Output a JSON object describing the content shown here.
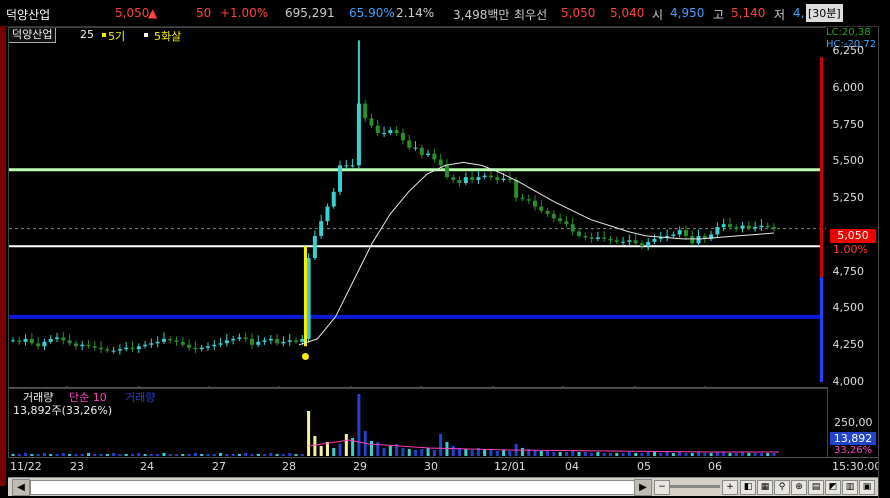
{
  "header": {
    "stock_name": "덕양산업",
    "price": "5,050",
    "up_arrow": "▲",
    "change": "50",
    "change_pct": "+1.00%",
    "volume": "695,291",
    "vol_ratio": "65.90%",
    "turnover": "2.14%",
    "trade_value": "3,498백만",
    "priority_label": "최우선",
    "ask": "5,050",
    "bid": "5,040",
    "open_label": "시",
    "open": "4,950",
    "high_label": "고",
    "high": "5,140",
    "low_label": "저",
    "low": "4,",
    "interval": "[30분]"
  },
  "legend": {
    "name": "덕양산업",
    "period": "25",
    "ma1": "5기",
    "ma2": "5화살"
  },
  "axis_right": {
    "lc": "LC:20,38",
    "hc": "HC:-20,72",
    "ticks": [
      "6,250",
      "6,000",
      "5,750",
      "5,500",
      "5,250",
      "5,000",
      "4,750",
      "4,500",
      "4,250",
      "4,000"
    ],
    "current_price": "5,050",
    "current_pct": "1.00%"
  },
  "volume_panel": {
    "label": "거래량",
    "label2": "단순 10",
    "label3": "거래량",
    "value": "13,892주(33,26%)",
    "tick": "250,00",
    "current": "13,892",
    "current_pct": "33,26%"
  },
  "x_axis": [
    "11/22",
    "23",
    "24",
    "27",
    "28",
    "29",
    "30",
    "12/01",
    "04",
    "05",
    "06"
  ],
  "time_label": "15:30:00",
  "colors": {
    "up": "#3ad0d0",
    "down": "#2a8c2a",
    "green_line": "#b8ffb0",
    "blue_line": "#0b1ad8",
    "white_line": "#ffffff",
    "yellow": "#f6f000",
    "price_box": "#e00000"
  },
  "chart_data": {
    "type": "candlestick",
    "ylim": [
      4000,
      6380
    ],
    "x": [
      "11/22",
      "23",
      "24",
      "27",
      "28",
      "29",
      "30",
      "12/01",
      "04",
      "05",
      "06"
    ],
    "closes": [
      4290,
      4280,
      4300,
      4270,
      4250,
      4280,
      4300,
      4310,
      4290,
      4270,
      4250,
      4260,
      4250,
      4240,
      4230,
      4220,
      4220,
      4230,
      4240,
      4230,
      4250,
      4260,
      4270,
      4280,
      4300,
      4290,
      4280,
      4260,
      4240,
      4230,
      4240,
      4250,
      4260,
      4270,
      4290,
      4300,
      4310,
      4300,
      4260,
      4280,
      4290,
      4300,
      4270,
      4280,
      4290,
      4280,
      4300,
      4850,
      5000,
      5100,
      5200,
      5300,
      5480,
      5480,
      5480,
      5900,
      5800,
      5750,
      5700,
      5700,
      5720,
      5700,
      5650,
      5600,
      5600,
      5550,
      5560,
      5520,
      5480,
      5400,
      5380,
      5360,
      5400,
      5380,
      5400,
      5410,
      5400,
      5380,
      5390,
      5380,
      5260,
      5250,
      5240,
      5200,
      5170,
      5150,
      5120,
      5100,
      5080,
      5030,
      5000,
      4990,
      4980,
      4990,
      4980,
      4970,
      4960,
      4960,
      4970,
      4950,
      4930,
      4960,
      4980,
      4990,
      5000,
      5010,
      5040,
      5000,
      4950,
      5000,
      4980,
      5010,
      5060,
      5080,
      5060,
      5050,
      5070,
      5050,
      5060,
      5070,
      5060,
      5050
    ],
    "horizontal_lines": [
      5450,
      4930,
      4450
    ],
    "ma_curve": [
      4260,
      4300,
      4450,
      4700,
      4950,
      5150,
      5300,
      5420,
      5480,
      5500,
      5480,
      5430,
      5370,
      5300,
      5230,
      5170,
      5110,
      5070,
      5030,
      5000,
      4990,
      4980,
      4980,
      4990,
      5000,
      5010,
      5020
    ]
  }
}
